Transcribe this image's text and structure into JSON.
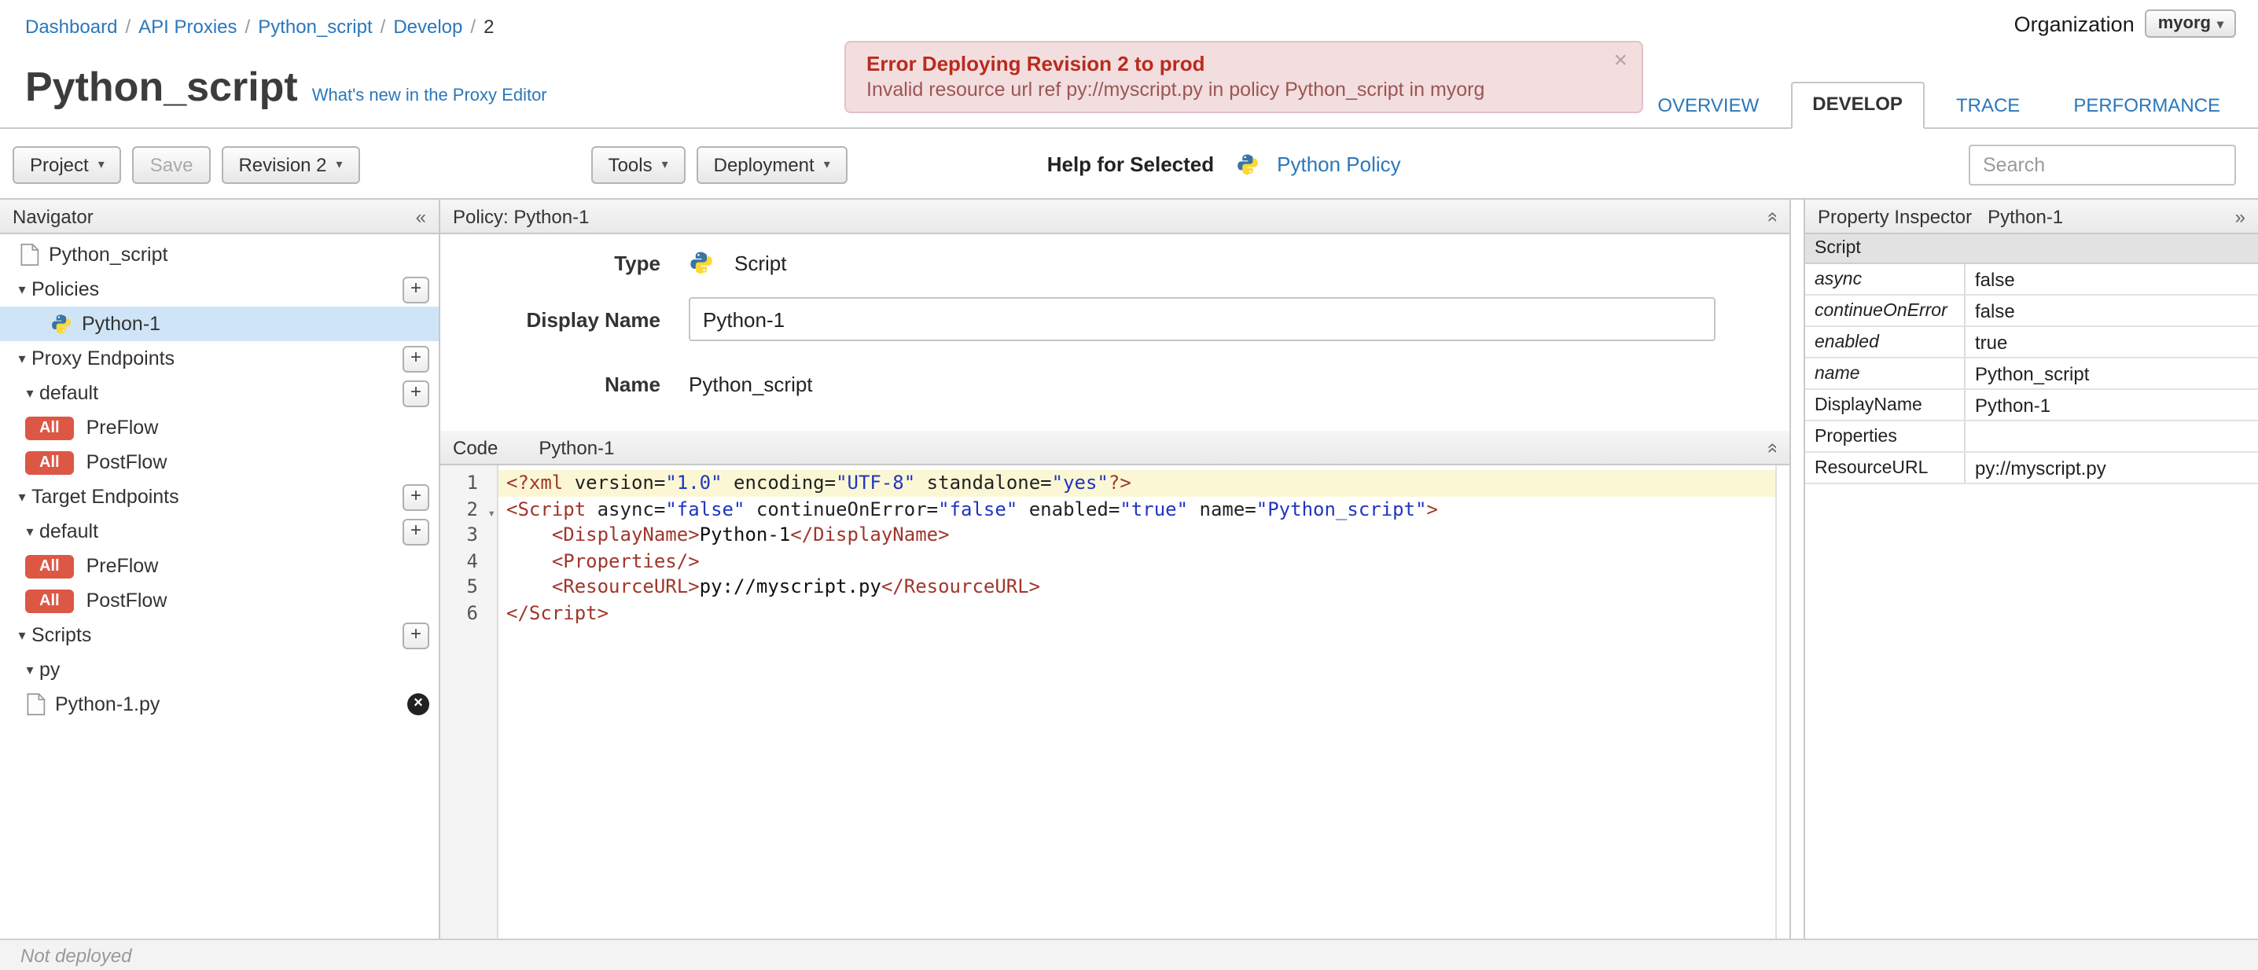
{
  "breadcrumb": {
    "items": [
      {
        "label": "Dashboard"
      },
      {
        "label": "API Proxies"
      },
      {
        "label": "Python_script"
      },
      {
        "label": "Develop"
      },
      {
        "label": "2"
      }
    ]
  },
  "organization": {
    "label": "Organization",
    "value": "myorg"
  },
  "error_banner": {
    "title": "Error Deploying Revision 2 to prod",
    "message": "Invalid resource url ref py://myscript.py in policy Python_script in myorg",
    "close_label": "×"
  },
  "page": {
    "title": "Python_script",
    "whats_new_link": "What's new in the Proxy Editor"
  },
  "tabs": {
    "items": [
      "OVERVIEW",
      "DEVELOP",
      "TRACE",
      "PERFORMANCE"
    ],
    "active": "DEVELOP"
  },
  "toolbar": {
    "project_label": "Project",
    "save_label": "Save",
    "revision_label": "Revision 2",
    "tools_label": "Tools",
    "deployment_label": "Deployment",
    "help_label": "Help for Selected",
    "policy_link_label": "Python Policy",
    "search_placeholder": "Search"
  },
  "navigator": {
    "title": "Navigator",
    "collapse_icon": "«",
    "items": [
      {
        "label": "Python_script"
      },
      {
        "label": "Policies"
      },
      {
        "label": "Python-1",
        "selected": true
      },
      {
        "label": "Proxy Endpoints"
      },
      {
        "label": "default"
      },
      {
        "badge": "All",
        "label": "PreFlow"
      },
      {
        "badge": "All",
        "label": "PostFlow"
      },
      {
        "label": "Target Endpoints"
      },
      {
        "label": "default"
      },
      {
        "badge": "All",
        "label": "PreFlow"
      },
      {
        "badge": "All",
        "label": "PostFlow"
      },
      {
        "label": "Scripts"
      },
      {
        "label": "py"
      },
      {
        "label": "Python-1.py"
      }
    ]
  },
  "policy_editor": {
    "header": "Policy: Python-1",
    "type_label": "Type",
    "type_value": "Script",
    "display_name_label": "Display Name",
    "display_name_value": "Python-1",
    "name_label": "Name",
    "name_value": "Python_script"
  },
  "code_editor": {
    "title": "Code",
    "subtitle": "Python-1",
    "active_line": 1,
    "lines": [
      {
        "n": 1,
        "tokens": [
          [
            "tag",
            "<?xml "
          ],
          [
            "attr",
            "version="
          ],
          [
            "str",
            "\"1.0\""
          ],
          [
            "attr",
            " encoding="
          ],
          [
            "str",
            "\"UTF-8\""
          ],
          [
            "attr",
            " standalone="
          ],
          [
            "str",
            "\"yes\""
          ],
          [
            "tag",
            "?>"
          ]
        ]
      },
      {
        "n": 2,
        "fold": true,
        "tokens": [
          [
            "tag",
            "<Script "
          ],
          [
            "attr",
            "async="
          ],
          [
            "str",
            "\"false\""
          ],
          [
            "attr",
            " continueOnError="
          ],
          [
            "str",
            "\"false\""
          ],
          [
            "attr",
            " enabled="
          ],
          [
            "str",
            "\"true\""
          ],
          [
            "attr",
            " name="
          ],
          [
            "str",
            "\"Python_script\""
          ],
          [
            "tag",
            ">"
          ]
        ]
      },
      {
        "n": 3,
        "tokens": [
          [
            "text",
            "    "
          ],
          [
            "tag",
            "<DisplayName>"
          ],
          [
            "text",
            "Python-1"
          ],
          [
            "tag",
            "</DisplayName>"
          ]
        ]
      },
      {
        "n": 4,
        "tokens": [
          [
            "text",
            "    "
          ],
          [
            "tag",
            "<Properties/>"
          ]
        ]
      },
      {
        "n": 5,
        "tokens": [
          [
            "text",
            "    "
          ],
          [
            "tag",
            "<ResourceURL>"
          ],
          [
            "text",
            "py://myscript.py"
          ],
          [
            "tag",
            "</ResourceURL>"
          ]
        ]
      },
      {
        "n": 6,
        "tokens": [
          [
            "tag",
            "</Script>"
          ]
        ]
      }
    ]
  },
  "property_inspector": {
    "title": "Property Inspector",
    "subtitle": "Python-1",
    "expand_icon": "»",
    "section": "Script",
    "rows": [
      {
        "name": "async",
        "value": "false",
        "italic": true
      },
      {
        "name": "continueOnError",
        "value": "false",
        "italic": true
      },
      {
        "name": "enabled",
        "value": "true",
        "italic": true
      },
      {
        "name": "name",
        "value": "Python_script",
        "italic": true
      },
      {
        "name": "DisplayName",
        "value": "Python-1",
        "italic": false
      },
      {
        "name": "Properties",
        "value": "",
        "italic": false
      },
      {
        "name": "ResourceURL",
        "value": "py://myscript.py",
        "italic": false
      }
    ]
  },
  "statusbar": {
    "text": "Not deployed"
  }
}
